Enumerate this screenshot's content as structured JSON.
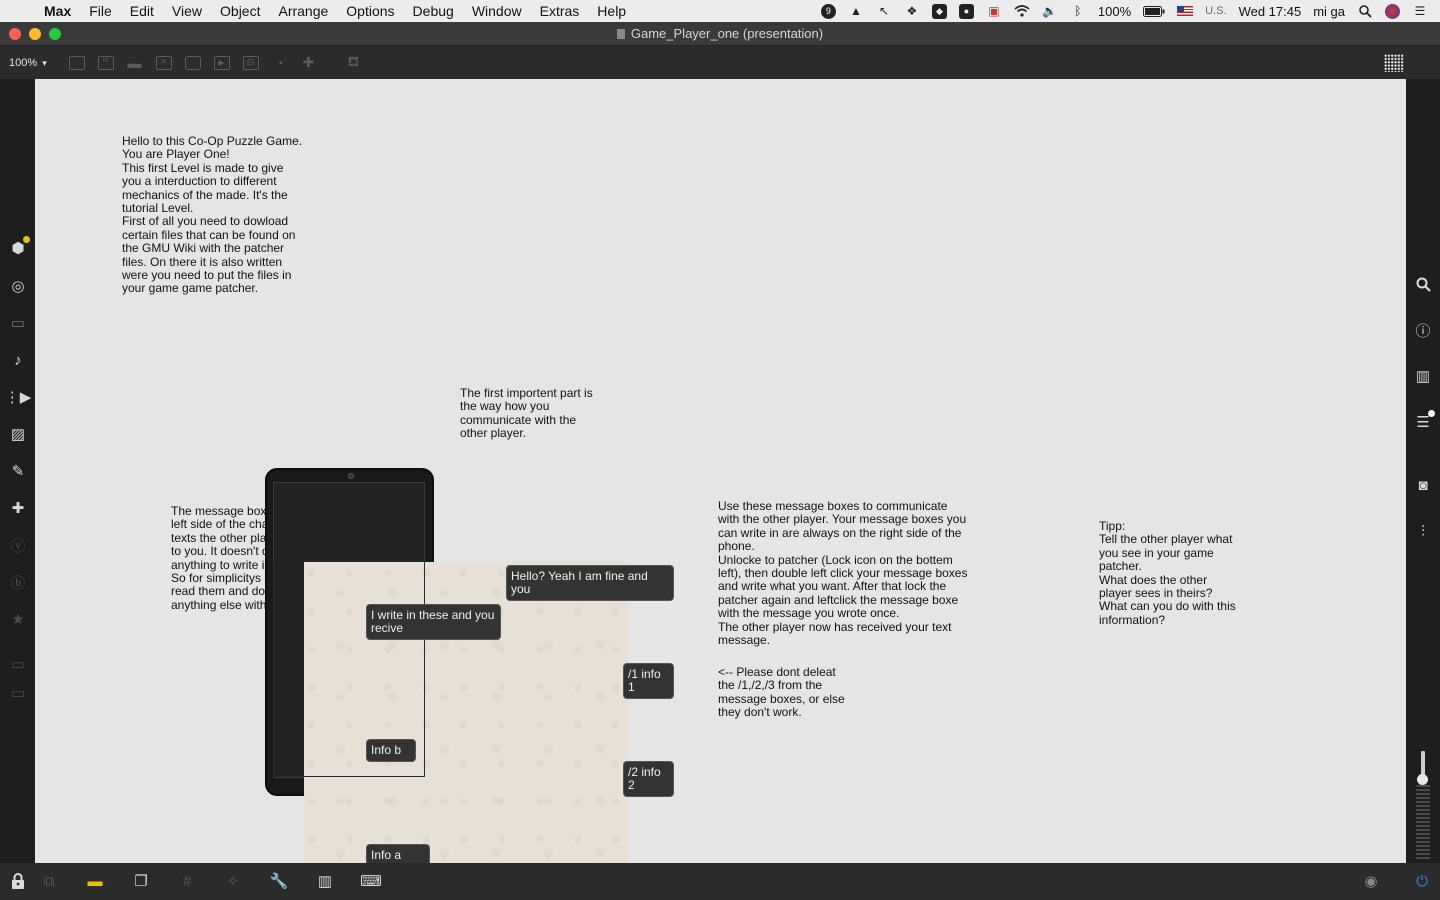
{
  "menubar": {
    "apple_glyph": "",
    "items": [
      "Max",
      "File",
      "Edit",
      "View",
      "Object",
      "Arrange",
      "Options",
      "Debug",
      "Window",
      "Extras",
      "Help"
    ],
    "tray_badge": "9",
    "battery": "100%",
    "input_source": "U.S.",
    "clock": "Wed 17:45",
    "user": "mi ga"
  },
  "window": {
    "title": "Game_Player_one (presentation)",
    "colors": {
      "close": "#ff5f57",
      "minimize": "#febc2e",
      "zoom": "#28c840"
    }
  },
  "toolbar": {
    "zoom": "100%",
    "zoom_caret": "▾"
  },
  "canvas": {
    "intro_text": "Hello to this Co-Op Puzzle Game.\nYou are Player One!\nThis first Level is made to give\nyou a interduction to different\nmechanics of the made. It's the\ntutorial Level.\nFirst of all you need to dowload\ncertain files that can be found on\nthe GMU Wiki with the patcher\nfiles. On there it is also written\nwere you need to put the files in\nyour game game patcher.",
    "important_text": "The first importent part is\nthe way how you\ncommunicate with the\nother player.",
    "message_box_left_text": "The message boxes on the\nleft side of the chat are the\ntexts the other player sends\nto you. It doesn't do\nanything to write in these.\nSo for simplicitys sake just\nread them and don't do\nanything else with them.",
    "instructions_text": "Use these message boxes to communicate\nwith the other player. Your message boxes you\ncan write in are always on the right side of the\nphone.\nUnlocke to patcher (Lock icon on the bottem\nleft), then double left click your message boxes\nand write what you want. After that lock the\npatcher again and leftclick the message boxe\nwith the message you wrote once.\nThe other player now has received your text\nmessage.",
    "warning_text": "<-- Please dont deleat\nthe /1,/2,/3 from the\nmessage boxes, or else\nthey don't work.",
    "tip_text": "Tipp:\nTell the other player what\nyou see in your game\npatcher.\nWhat does the other\nplayer sees in theirs?\nWhat can you do with this\ninformation?",
    "messages": {
      "reply": "Hello? Yeah I am fine and you",
      "write_hint": "I write in these and you\nrecive",
      "info1": "/1 info 1",
      "info_b": "Info b",
      "info2": "/2 info 2",
      "info_a": "Info a"
    }
  }
}
